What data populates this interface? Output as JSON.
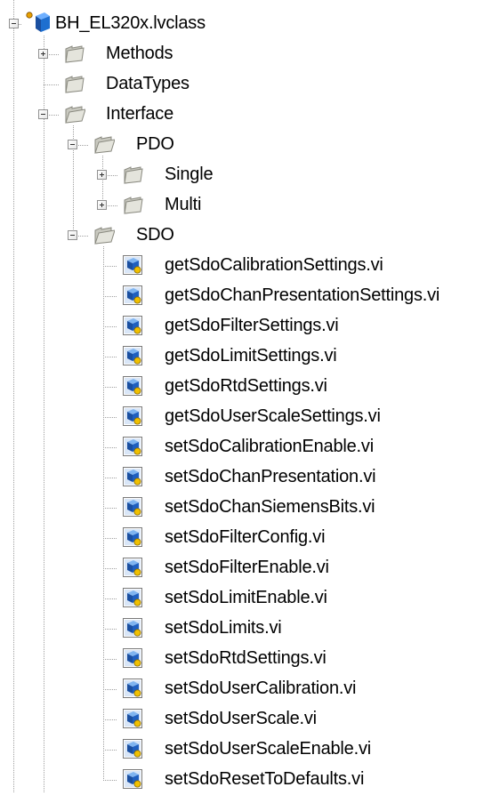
{
  "tree": {
    "root": {
      "label": "BH_EL320x.lvclass",
      "icon": "lvclass-cube-icon"
    },
    "folders": {
      "methods": {
        "label": "Methods",
        "expander": "plus"
      },
      "datatypes": {
        "label": "DataTypes"
      },
      "interface": {
        "label": "Interface",
        "expander": "minus"
      },
      "pdo": {
        "label": "PDO",
        "expander": "minus"
      },
      "single": {
        "label": "Single",
        "expander": "plus"
      },
      "multi": {
        "label": "Multi",
        "expander": "plus"
      },
      "sdo": {
        "label": "SDO",
        "expander": "minus"
      }
    },
    "sdo_items": [
      "getSdoCalibrationSettings.vi",
      "getSdoChanPresentationSettings.vi",
      "getSdoFilterSettings.vi",
      "getSdoLimitSettings.vi",
      "getSdoRtdSettings.vi",
      "getSdoUserScaleSettings.vi",
      "setSdoCalibrationEnable.vi",
      "setSdoChanPresentation.vi",
      "setSdoChanSiemensBits.vi",
      "setSdoFilterConfig.vi",
      "setSdoFilterEnable.vi",
      "setSdoLimitEnable.vi",
      "setSdoLimits.vi",
      "setSdoRtdSettings.vi",
      "setSdoUserCalibration.vi",
      "setSdoUserScale.vi",
      "setSdoUserScaleEnable.vi",
      "setSdoResetToDefaults.vi"
    ]
  },
  "colors": {
    "tree_line": "#a0a0a0",
    "folder_fill": "#d8d8d0",
    "vi_blue": "#1f5fbf",
    "vi_yellow": "#f0c000",
    "cube_blue": "#1e6fd0"
  }
}
